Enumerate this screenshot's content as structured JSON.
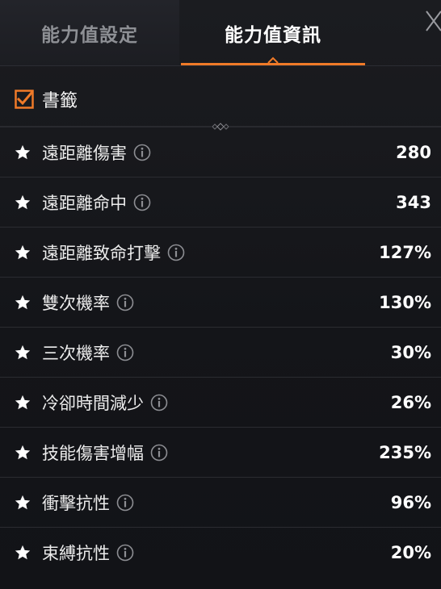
{
  "tabs": [
    {
      "label": "能力值設定",
      "active": false
    },
    {
      "label": "能力值資訊",
      "active": true
    }
  ],
  "accent_color": "#f07a28",
  "bookmark": {
    "label": "書籤",
    "checked": true
  },
  "stats": [
    {
      "name": "遠距離傷害",
      "value": "280"
    },
    {
      "name": "遠距離命中",
      "value": "343"
    },
    {
      "name": "遠距離致命打擊",
      "value": "127%"
    },
    {
      "name": "雙次機率",
      "value": "130%"
    },
    {
      "name": "三次機率",
      "value": "30%"
    },
    {
      "name": "冷卻時間減少",
      "value": "26%"
    },
    {
      "name": "技能傷害增幅",
      "value": "235%"
    },
    {
      "name": "衝擊抗性",
      "value": "96%"
    },
    {
      "name": "束縛抗性",
      "value": "20%"
    }
  ]
}
